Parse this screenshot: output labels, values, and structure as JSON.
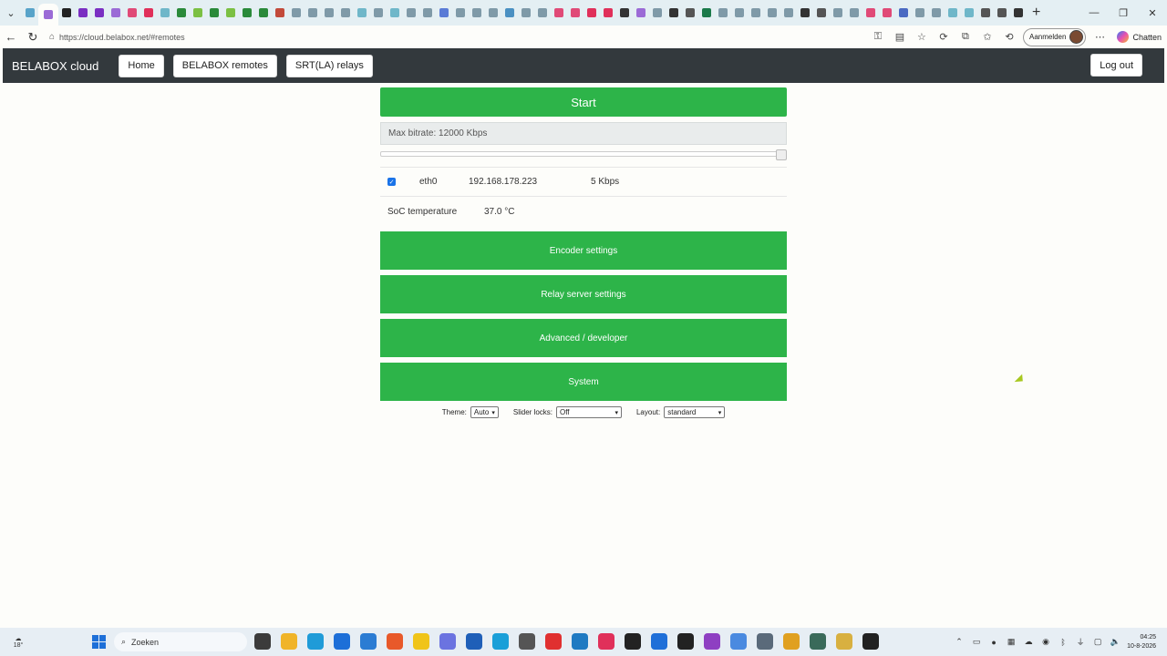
{
  "browser": {
    "url": "https://cloud.belabox.net/#remotes",
    "signin_label": "Aanmelden",
    "copilot_label": "Chatten",
    "tab_colors": [
      "#58a3c9",
      "#9b6bd6",
      "#222",
      "#7a2fc2",
      "#7a2fc2",
      "#9b6bd6",
      "#e04a77",
      "#e0305a",
      "#6fb7c9",
      "#2a8a3a",
      "#7bc043",
      "#2a8a3a",
      "#7bc043",
      "#2a8a3a",
      "#2a8a3a",
      "#c24a3a",
      "#7f9aa8",
      "#7f9aa8",
      "#7f9aa8",
      "#7f9aa8",
      "#6fb7c9",
      "#7f9aa8",
      "#6fb7c9",
      "#7f9aa8",
      "#7f9aa8",
      "#5a7bd6",
      "#7f9aa8",
      "#7f9aa8",
      "#7f9aa8",
      "#4a90c2",
      "#7f9aa8",
      "#7f9aa8",
      "#e04a77",
      "#e04a77",
      "#e0305a",
      "#e0305a",
      "#333",
      "#9b6bd6",
      "#7f9aa8",
      "#333",
      "#555",
      "#1b7a4a",
      "#7f9aa8",
      "#7f9aa8",
      "#7f9aa8",
      "#7f9aa8",
      "#7f9aa8",
      "#333",
      "#555",
      "#7f9aa8",
      "#7f9aa8",
      "#e04a77",
      "#e04a77",
      "#4a6ac2",
      "#7f9aa8",
      "#7f9aa8",
      "#6fb7c9",
      "#6fb7c9",
      "#555",
      "#555",
      "#333"
    ]
  },
  "navbar": {
    "brand": "BELABOX cloud",
    "links": [
      "Home",
      "BELABOX remotes",
      "SRT(LA) relays"
    ],
    "logout": "Log out"
  },
  "main": {
    "start_label": "Start",
    "bitrate_label": "Max bitrate: 12000 Kbps",
    "bitrate_fraction": 1.0,
    "network": {
      "enabled": true,
      "interface": "eth0",
      "ip": "192.168.178.223",
      "throughput": "5 Kbps"
    },
    "temperature": {
      "label": "SoC temperature",
      "value": "37.0 °C"
    },
    "panels": [
      "Encoder settings",
      "Relay server settings",
      "Advanced / developer",
      "System"
    ],
    "prefs": {
      "theme_label": "Theme:",
      "theme_value": "Auto",
      "slider_locks_label": "Slider locks:",
      "slider_locks_value": "Off",
      "layout_label": "Layout:",
      "layout_value": "standard"
    }
  },
  "taskbar": {
    "weather": "18°",
    "search_placeholder": "Zoeken",
    "time": "04:25",
    "date": "10-8-2026",
    "app_colors": [
      "#3b3b3b",
      "#f0b429",
      "#1f9bd8",
      "#1d6fd8",
      "#2b7cd3",
      "#e8592a",
      "#f0c419",
      "#6b73e0",
      "#1f5fb8",
      "#1a9fd8",
      "#555",
      "#e03030",
      "#1f7ac2",
      "#e0305a",
      "#222",
      "#1f6fd8",
      "#222",
      "#8e3fc2",
      "#4a8ae0",
      "#5a6a7a",
      "#e0a020",
      "#3a6a5a",
      "#d8b040",
      "#222"
    ]
  }
}
